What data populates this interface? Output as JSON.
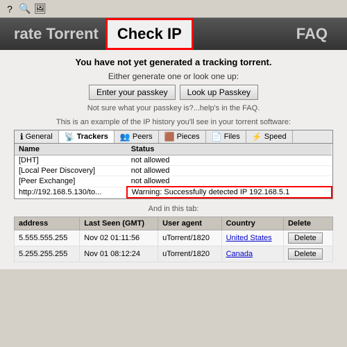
{
  "toolbar": {
    "icons": [
      "?",
      "📷",
      "🖼"
    ]
  },
  "navbar": {
    "partial_label": "rate Torrent",
    "checkip_label": "Check IP",
    "faq_label": "FAQ"
  },
  "main": {
    "headline": "You have not yet generated a tracking torrent.",
    "generate_line": "Either generate one or look one up:",
    "enter_passkey_btn": "Enter your passkey",
    "lookup_passkey_btn": "Look up Passkey",
    "helptext": "Not sure what your passkey is?...help's in the FAQ.",
    "example_text": "This is an example of the IP history you'll see in your torrent software:",
    "torrent_tabs": [
      {
        "label": "General",
        "icon": "ℹ",
        "active": false
      },
      {
        "label": "Trackers",
        "icon": "📡",
        "active": true
      },
      {
        "label": "Peers",
        "icon": "🔗",
        "active": false
      },
      {
        "label": "Pieces",
        "icon": "🟤",
        "active": false
      },
      {
        "label": "Files",
        "icon": "📄",
        "active": false
      },
      {
        "label": "Speed",
        "icon": "⚡",
        "active": false
      }
    ],
    "torrent_rows": [
      {
        "name": "[DHT]",
        "status": "not allowed"
      },
      {
        "name": "[Local Peer Discovery]",
        "status": "not allowed"
      },
      {
        "name": "[Peer Exchange]",
        "status": "not allowed"
      },
      {
        "name": "http://192.168.5.130/to...",
        "status": "Warning:",
        "highlight": "Successfully detected IP 192.168.5.1"
      }
    ],
    "and_in_tab": "And in this tab:",
    "ip_table_headers": [
      "address",
      "Last Seen (GMT)",
      "User agent",
      "Country",
      "Delete"
    ],
    "ip_rows": [
      {
        "address": "5.555.555.255",
        "last_seen": "Nov 02 01:11:56",
        "user_agent": "uTorrent/1820",
        "country": "United States",
        "country_link": true,
        "delete_btn": "Delete"
      },
      {
        "address": "5.255.255.255",
        "last_seen": "Nov 01 08:12:24",
        "user_agent": "uTorrent/1820",
        "country": "Canada",
        "country_link": true,
        "delete_btn": "Delete"
      }
    ]
  }
}
